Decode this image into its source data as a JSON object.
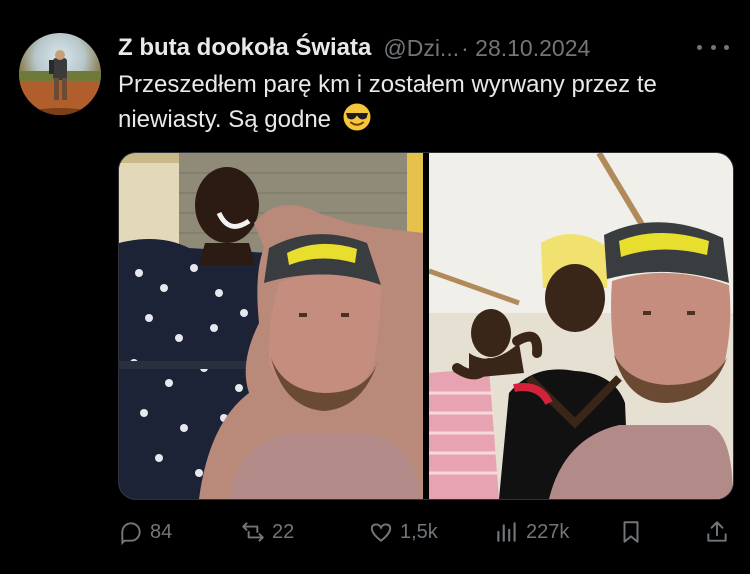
{
  "tweet": {
    "author_name": "Z buta dookoła Świata",
    "handle": "@Dzi...",
    "date": "· 28.10.2024",
    "text": "Przeszedłem parę km i zostałem wyrwany przez te niewiasty. Są godne",
    "emoji_icon": "smiling-face-with-sunglasses-icon"
  },
  "actions": {
    "replies": "84",
    "reposts": "22",
    "likes": "1,5k",
    "views": "227k"
  },
  "colors": {
    "background": "#000000",
    "text": "#e7e9ea",
    "muted": "#71767b"
  }
}
